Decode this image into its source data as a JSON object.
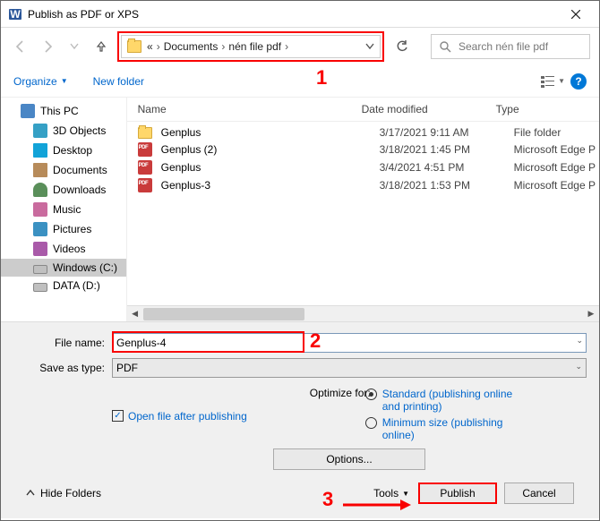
{
  "window": {
    "title": "Publish as PDF or XPS",
    "close_icon": "close"
  },
  "nav": {
    "address": {
      "root_chev": "«",
      "segment1": "Documents",
      "segment2": "nén file pdf"
    },
    "search_placeholder": "Search nén file pdf"
  },
  "toolbar": {
    "organize": "Organize",
    "new_folder": "New folder"
  },
  "tree": {
    "items": [
      {
        "label": "This PC",
        "icon": "pc"
      },
      {
        "label": "3D Objects",
        "icon": "3d"
      },
      {
        "label": "Desktop",
        "icon": "desk"
      },
      {
        "label": "Documents",
        "icon": "doc"
      },
      {
        "label": "Downloads",
        "icon": "dl"
      },
      {
        "label": "Music",
        "icon": "music"
      },
      {
        "label": "Pictures",
        "icon": "pic"
      },
      {
        "label": "Videos",
        "icon": "vid"
      },
      {
        "label": "Windows (C:)",
        "icon": "drive",
        "selected": true
      },
      {
        "label": "DATA (D:)",
        "icon": "drive"
      }
    ]
  },
  "columns": {
    "name": "Name",
    "date": "Date modified",
    "type": "Type"
  },
  "rows": [
    {
      "icon": "folder",
      "name": "Genplus",
      "date": "3/17/2021 9:11 AM",
      "type": "File folder"
    },
    {
      "icon": "pdf",
      "name": "Genplus (2)",
      "date": "3/18/2021 1:45 PM",
      "type": "Microsoft Edge P"
    },
    {
      "icon": "pdf",
      "name": "Genplus",
      "date": "3/4/2021 4:51 PM",
      "type": "Microsoft Edge P"
    },
    {
      "icon": "pdf",
      "name": "Genplus-3",
      "date": "3/18/2021 1:53 PM",
      "type": "Microsoft Edge P"
    }
  ],
  "fields": {
    "file_name_label": "File name:",
    "file_name_value": "Genplus-4",
    "save_type_label": "Save as type:",
    "save_type_value": "PDF"
  },
  "options": {
    "check_label": "Open file after publishing",
    "optimize_label": "Optimize for:",
    "radio1": "Standard (publishing online and printing)",
    "radio2": "Minimum size (publishing online)",
    "options_btn": "Options..."
  },
  "footer": {
    "hide_folders": "Hide Folders",
    "tools": "Tools",
    "publish": "Publish",
    "cancel": "Cancel"
  },
  "annotations": {
    "a1": "1",
    "a2": "2",
    "a3": "3"
  }
}
